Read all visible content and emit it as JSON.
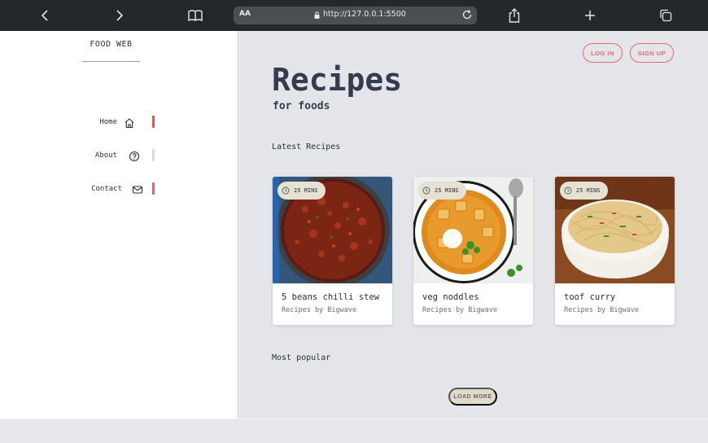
{
  "browser": {
    "url": "http://127.0.0.1:5500",
    "aa_label": "AA"
  },
  "sidebar": {
    "brand": "FOOD WEB",
    "items": [
      {
        "label": "Home",
        "icon": "home-icon",
        "indicator_color": "#e2574c"
      },
      {
        "label": "About",
        "icon": "question-circle-icon",
        "indicator_color": "#d9d9dd"
      },
      {
        "label": "Contact",
        "icon": "mail-icon",
        "indicator_color": "#e05a8a"
      }
    ]
  },
  "header": {
    "login_label": "LOG IN",
    "signup_label": "SIGN UP",
    "accent_color": "#e46a6a"
  },
  "hero": {
    "title": "Recipes",
    "subtitle": "for foods"
  },
  "latest": {
    "heading": "Latest Recipes",
    "cards": [
      {
        "time": "25 MINS",
        "name": "5 beans chilli stew",
        "author": "Recipes by Bigwave",
        "image": "chilli-stew"
      },
      {
        "time": "25 MINS",
        "name": "veg noddles",
        "author": "Recipes by Bigwave",
        "image": "curry"
      },
      {
        "time": "25 MINS",
        "name": "toof curry",
        "author": "Recipes by Bigwave",
        "image": "noodles"
      }
    ]
  },
  "popular": {
    "heading": "Most popular",
    "load_more_label": "LOAD MORE"
  }
}
